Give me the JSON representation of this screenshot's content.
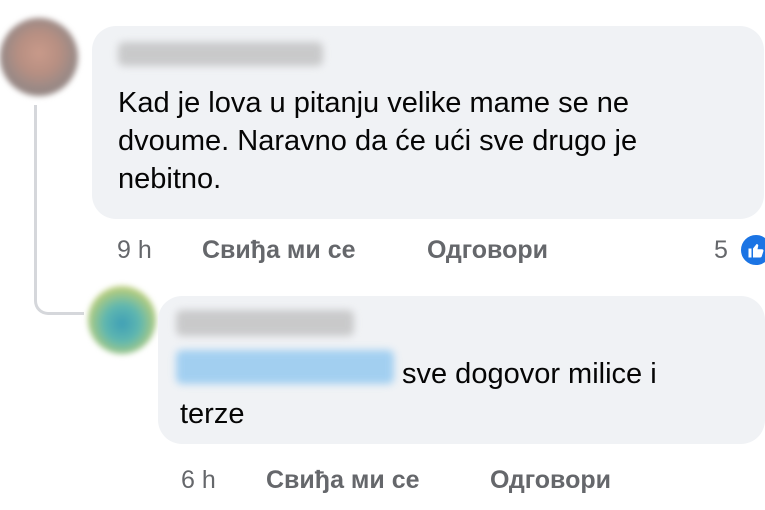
{
  "comment1": {
    "text": "Kad je lova u pitanju velike mame se ne dvoume. Naravno da će ući sve drugo je nebitno.",
    "time": "9 h",
    "like_label": "Свиђа ми се",
    "reply_label": "Одговори",
    "like_count": "5"
  },
  "comment2": {
    "text_after_mention": "sve dogovor milice i",
    "text_line2": "terze",
    "time": "6 h",
    "like_label": "Свиђа ми се",
    "reply_label": "Одговори"
  },
  "colors": {
    "bubble": "#f0f2f5",
    "meta_text": "#65676b",
    "like_blue": "#1b74e4"
  },
  "icons": {
    "reaction": "thumbs-up-icon"
  }
}
